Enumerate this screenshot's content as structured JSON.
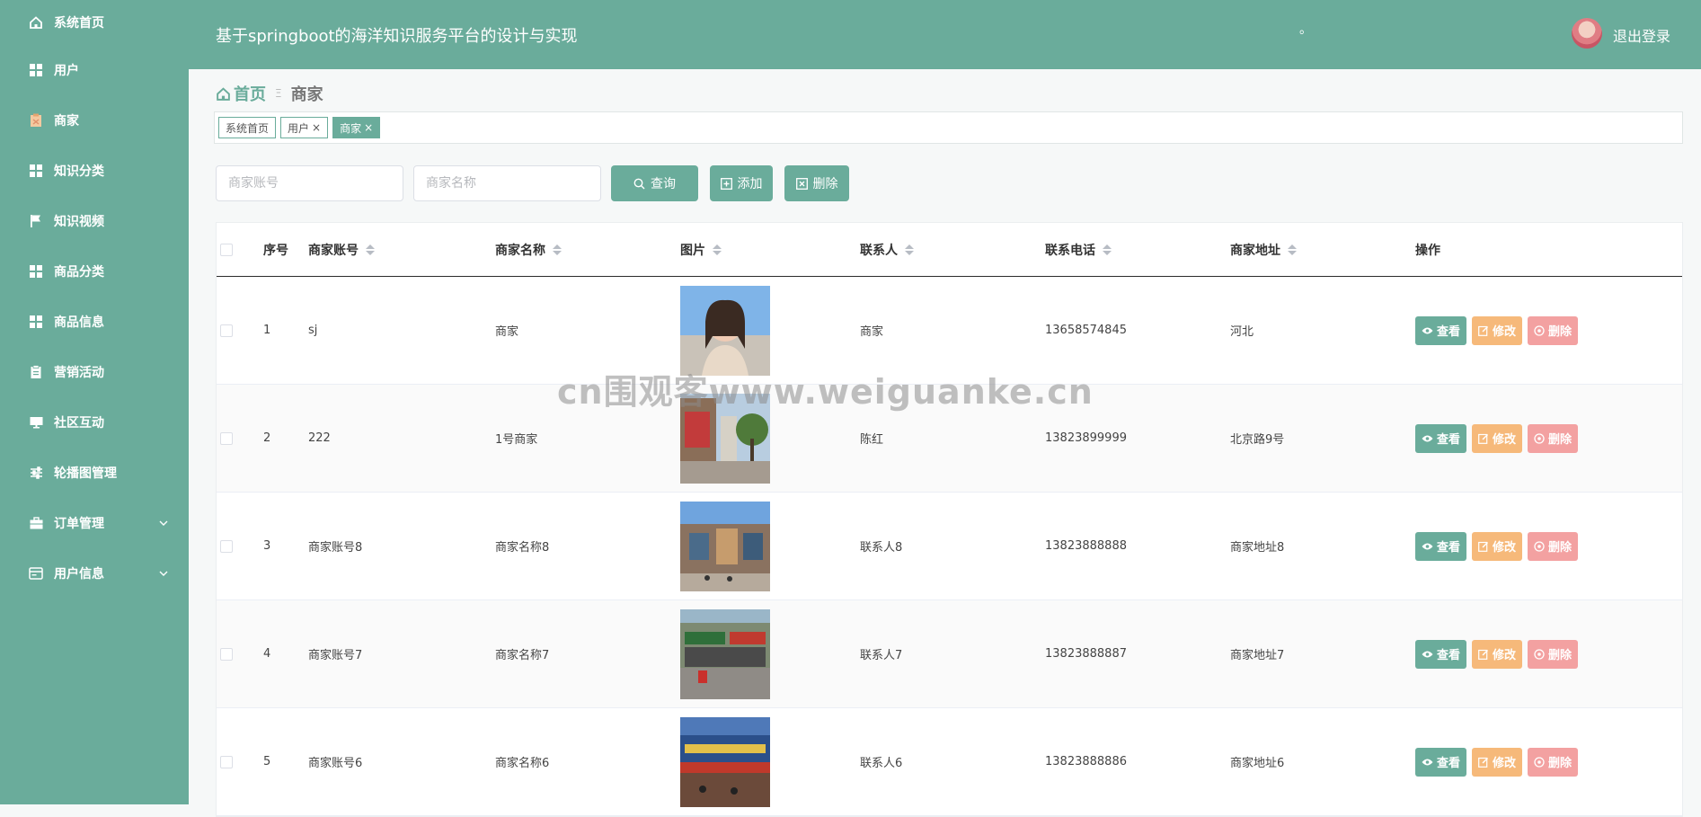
{
  "sidebar": {
    "items": [
      {
        "label": "系统首页",
        "icon": "home-icon"
      },
      {
        "label": "用户",
        "icon": "grid-icon"
      },
      {
        "label": "商家",
        "icon": "clipboard-icon"
      },
      {
        "label": "知识分类",
        "icon": "grid-icon"
      },
      {
        "label": "知识视频",
        "icon": "flag-icon"
      },
      {
        "label": "商品分类",
        "icon": "grid-icon"
      },
      {
        "label": "商品信息",
        "icon": "grid-icon"
      },
      {
        "label": "营销活动",
        "icon": "clipboard-icon"
      },
      {
        "label": "社区互动",
        "icon": "monitor-icon"
      },
      {
        "label": "轮播图管理",
        "icon": "sliders-icon"
      },
      {
        "label": "订单管理",
        "icon": "briefcase-icon"
      },
      {
        "label": "用户信息",
        "icon": "card-icon"
      }
    ]
  },
  "header": {
    "title": "基于springboot的海洋知识服务平台的设计与实现",
    "dot": "。",
    "logout_label": "退出登录"
  },
  "breadcrumb": {
    "home": "首页",
    "separator": "Ξ",
    "current": "商家"
  },
  "tags": [
    {
      "label": "系统首页",
      "closable": false,
      "active": false
    },
    {
      "label": "用户",
      "closable": true,
      "active": false
    },
    {
      "label": "商家",
      "closable": true,
      "active": true
    }
  ],
  "tag_close": "×",
  "search": {
    "account_placeholder": "商家账号",
    "name_placeholder": "商家名称",
    "query_label": "查询",
    "add_label": "添加",
    "delete_label": "删除"
  },
  "table": {
    "headers": {
      "no": "序号",
      "account": "商家账号",
      "name": "商家名称",
      "image": "图片",
      "contact": "联系人",
      "phone": "联系电话",
      "address": "商家地址",
      "ops": "操作"
    },
    "actions": {
      "view": "查看",
      "edit": "修改",
      "delete": "删除"
    },
    "rows": [
      {
        "no": "1",
        "account": "sj",
        "name": "商家",
        "contact": "商家",
        "phone": "13658574845",
        "address": "河北"
      },
      {
        "no": "2",
        "account": "222",
        "name": "1号商家",
        "contact": "陈红",
        "phone": "13823899999",
        "address": "北京路9号"
      },
      {
        "no": "3",
        "account": "商家账号8",
        "name": "商家名称8",
        "contact": "联系人8",
        "phone": "13823888888",
        "address": "商家地址8"
      },
      {
        "no": "4",
        "account": "商家账号7",
        "name": "商家名称7",
        "contact": "联系人7",
        "phone": "13823888887",
        "address": "商家地址7"
      },
      {
        "no": "5",
        "account": "商家账号6",
        "name": "商家名称6",
        "contact": "联系人6",
        "phone": "13823888886",
        "address": "商家地址6"
      }
    ]
  },
  "watermark": "cn围观客www.weiguanke.cn",
  "colors": {
    "primary": "#6aac9b",
    "edit": "#f6b97a",
    "delete": "#f3a1a1",
    "background": "#f6f8f8"
  }
}
